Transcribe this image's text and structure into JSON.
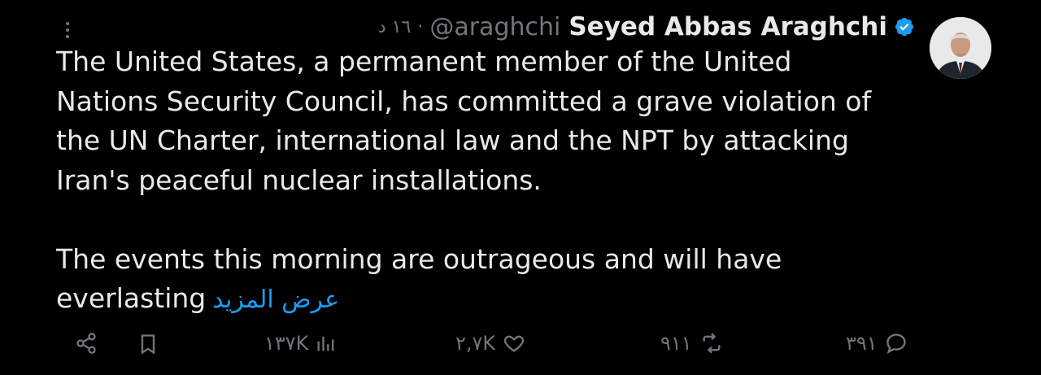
{
  "tweet": {
    "author_name": "Seyed Abbas Araghchi",
    "handle": "@araghchi",
    "separator": "·",
    "time": "١٦ د",
    "text": "The United States, a permanent member of the United\nNations Security Council, has committed a grave violation of\nthe UN Charter, international law and the NPT by attacking\nIran's peaceful nuclear installations.\n\nThe events this morning are outrageous and will have\neverlasting",
    "show_more": "عرض المزيد",
    "verified": true
  },
  "actions": {
    "replies": "٣٩١",
    "reposts": "٩١١",
    "likes": "٢,٧K",
    "views": "١٣٧K"
  },
  "icons": [
    "more-icon",
    "verified-icon",
    "share-icon",
    "bookmark-icon",
    "views-icon",
    "like-icon",
    "repost-icon",
    "reply-icon"
  ],
  "colors": {
    "background": "#000000",
    "text": "#e7e9ea",
    "muted": "#71767b",
    "accent": "#1d9bf0"
  }
}
